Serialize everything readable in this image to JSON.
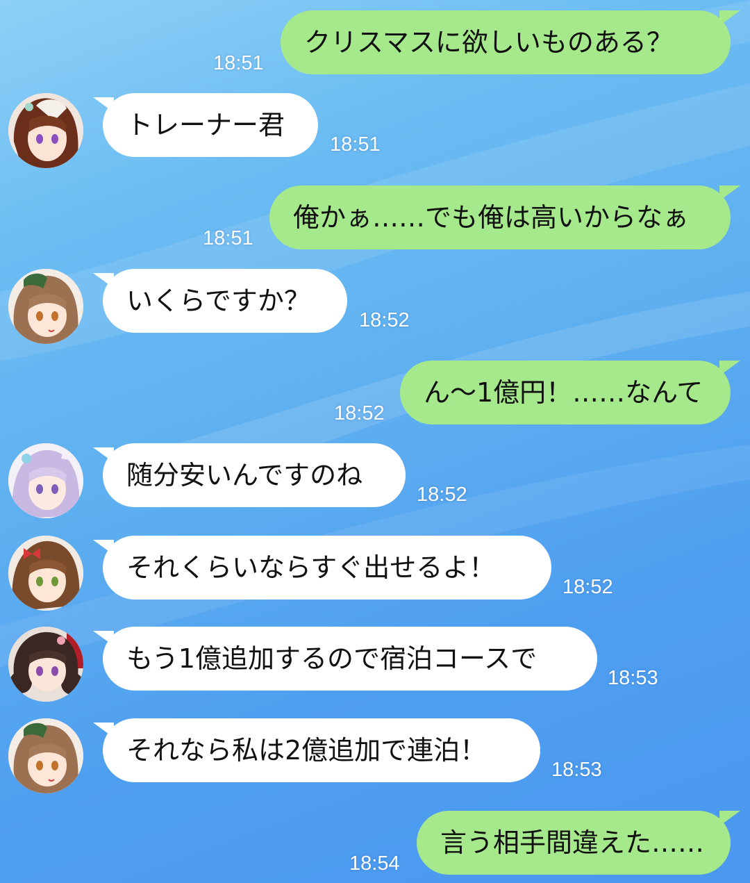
{
  "chat": {
    "messages": [
      {
        "id": 1,
        "side": "out",
        "text": "クリスマスに欲しいものある？",
        "time": "18:51"
      },
      {
        "id": 2,
        "side": "in",
        "avatar": "avatar-brown-hair-white-stripe",
        "text": "トレーナー君",
        "time": "18:51"
      },
      {
        "id": 3,
        "side": "out",
        "text": "俺かぁ……でも俺は高いからなぁ",
        "time": "18:51"
      },
      {
        "id": 4,
        "side": "in",
        "avatar": "avatar-light-brown-hair-green-hat",
        "text": "いくらですか？",
        "time": "18:52"
      },
      {
        "id": 5,
        "side": "out",
        "text": "ん〜1億円！……なんて",
        "time": "18:52"
      },
      {
        "id": 6,
        "side": "in",
        "avatar": "avatar-lavender-hair",
        "text": "随分安いんですのね",
        "time": "18:52"
      },
      {
        "id": 7,
        "side": "in",
        "avatar": "avatar-brown-hair-red-ribbon",
        "text": "それくらいならすぐ出せるよ！",
        "time": "18:52"
      },
      {
        "id": 8,
        "side": "in",
        "avatar": "avatar-dark-curly-hair",
        "text": "もう1億追加するので宿泊コースで",
        "time": "18:53"
      },
      {
        "id": 9,
        "side": "in",
        "avatar": "avatar-light-brown-hair-green-hat",
        "text": "それなら私は2億追加で連泊！",
        "time": "18:53"
      },
      {
        "id": 10,
        "side": "out",
        "text": "言う相手間違えた……",
        "time": "18:54"
      }
    ]
  },
  "colors": {
    "outgoing_bubble": "#a6e88c",
    "incoming_bubble": "#ffffff",
    "timestamp": "#ffffff",
    "background": "#5fb0f0"
  }
}
